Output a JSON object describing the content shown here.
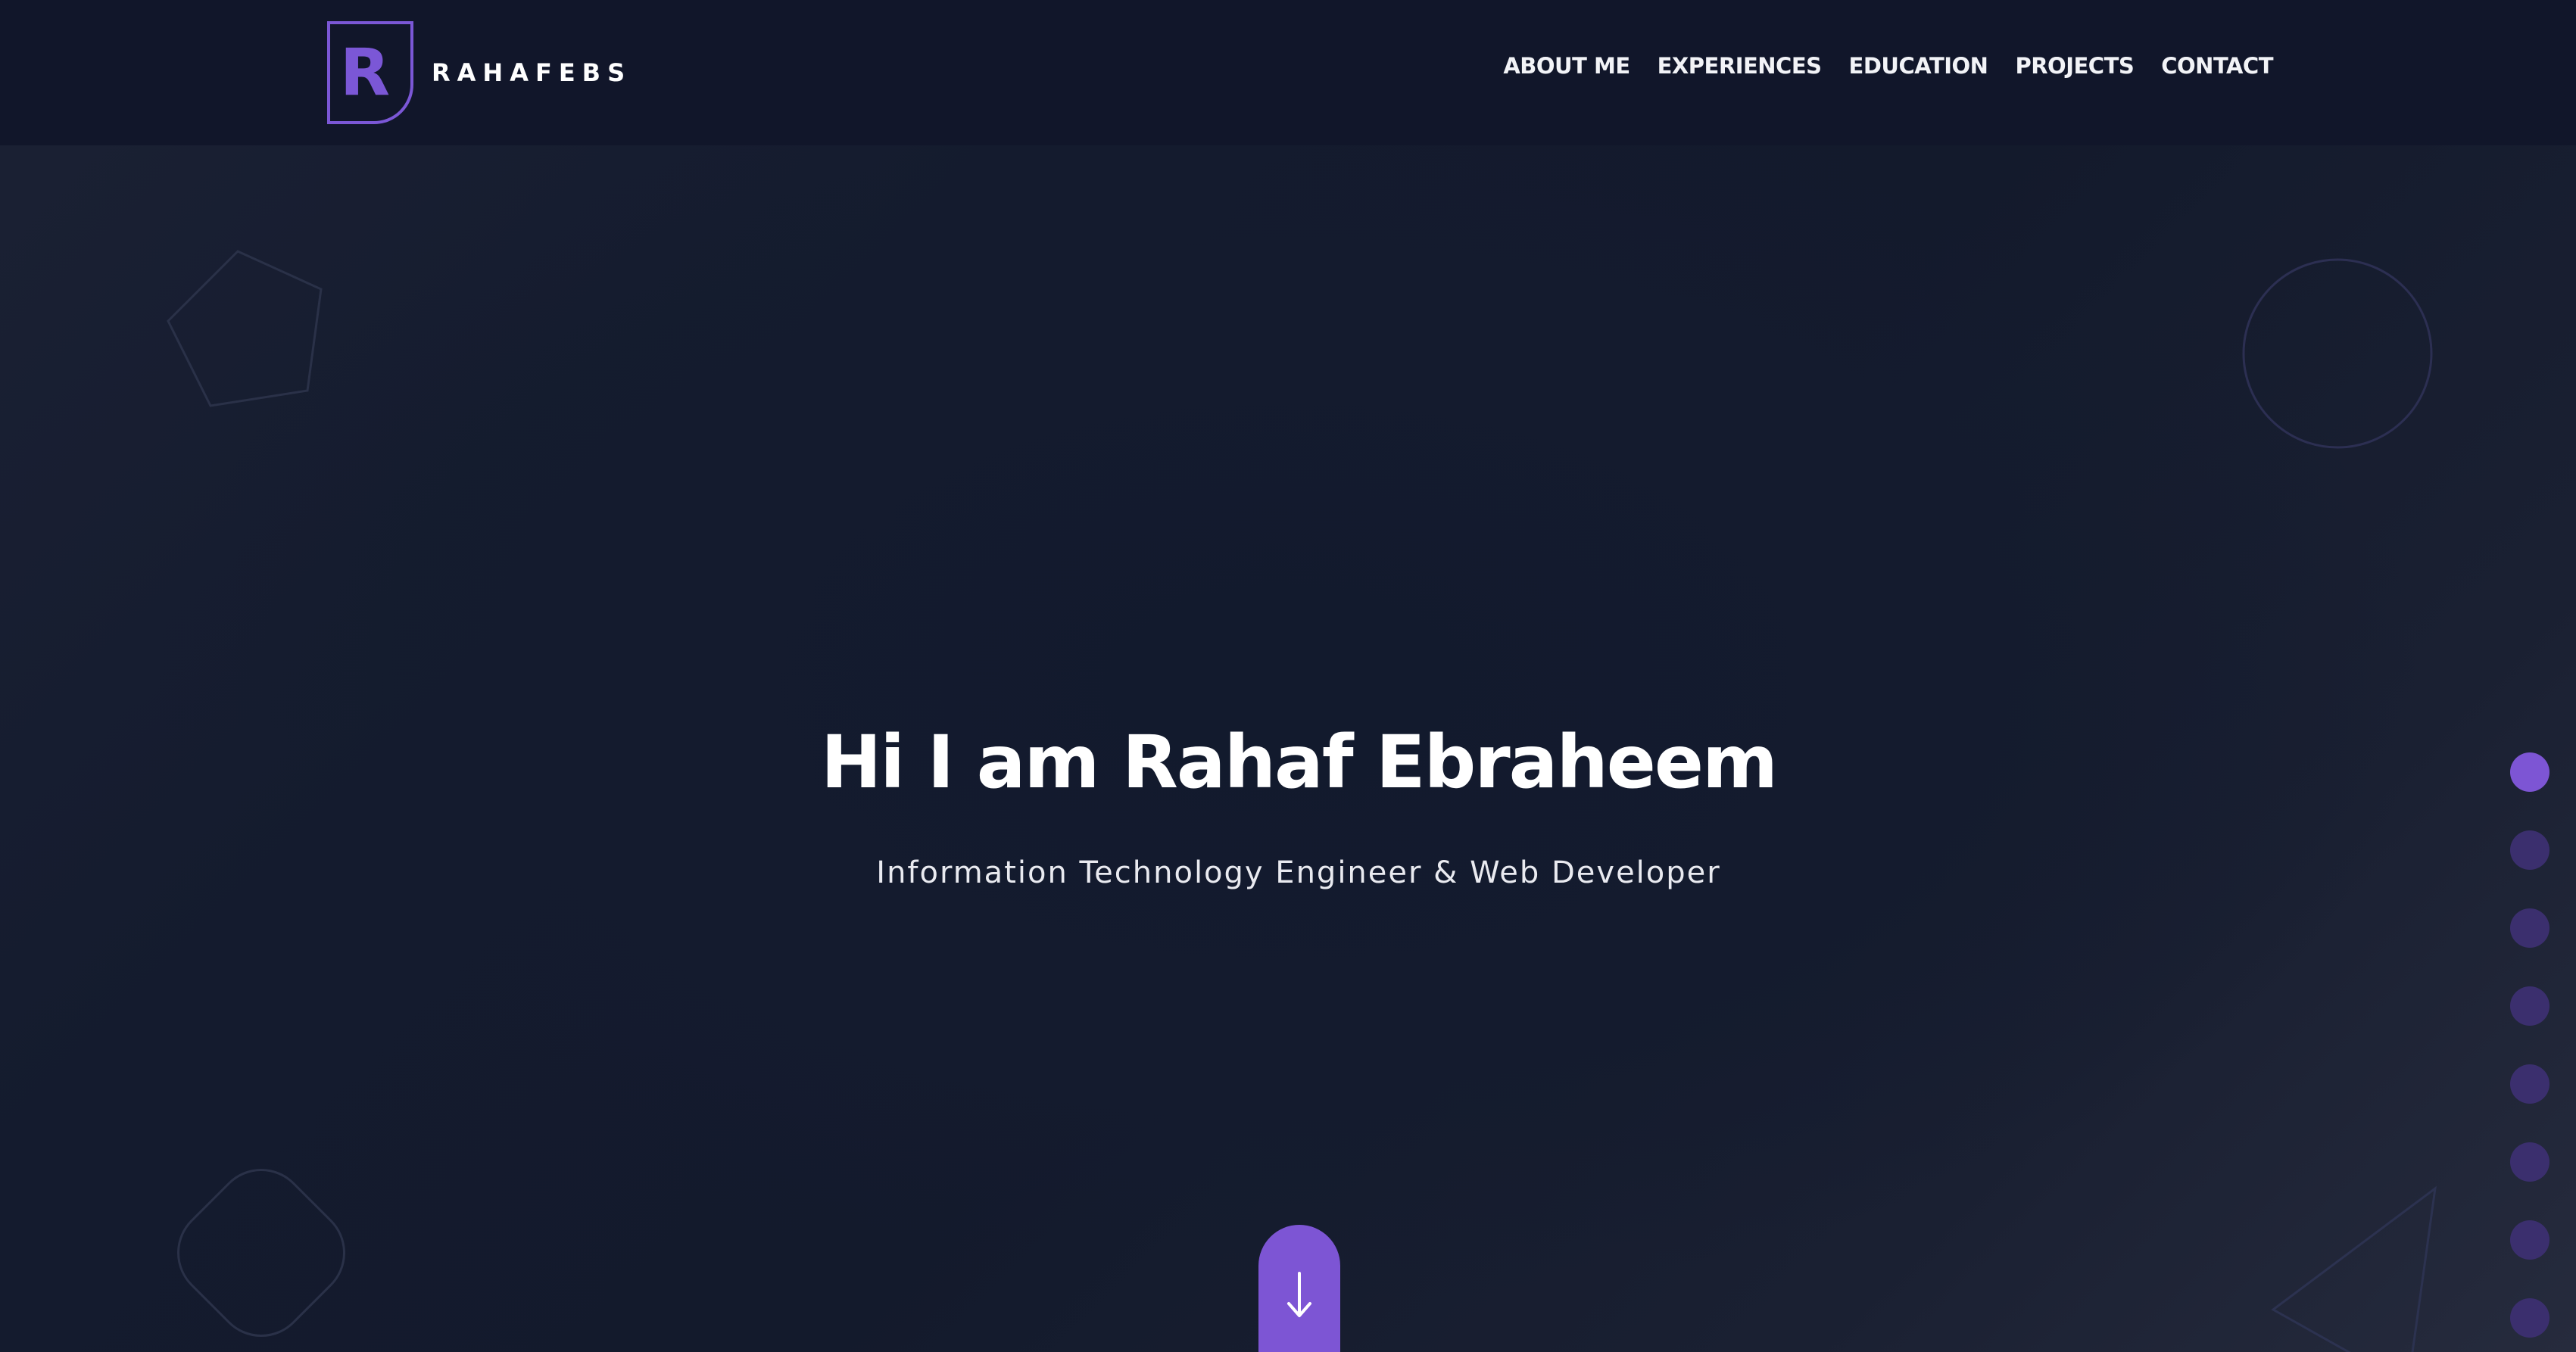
{
  "brand": {
    "logo_letter": "R",
    "name": "RAHAFEBS"
  },
  "nav": {
    "items": [
      {
        "label": "ABOUT ME"
      },
      {
        "label": "EXPERIENCES"
      },
      {
        "label": "EDUCATION"
      },
      {
        "label": "PROJECTS"
      },
      {
        "label": "CONTACT"
      }
    ]
  },
  "hero": {
    "title": "Hi I am Rahaf Ebraheem",
    "subtitle": "Information Technology Engineer & Web Developer",
    "scroll_icon": "arrow-down-icon"
  },
  "pagination": {
    "count": 8,
    "active_index": 0
  },
  "colors": {
    "accent": "#7d55d4",
    "header_bg": "#11162a",
    "page_bg": "#141b2e",
    "dot_inactive": "#3b2f6e"
  }
}
